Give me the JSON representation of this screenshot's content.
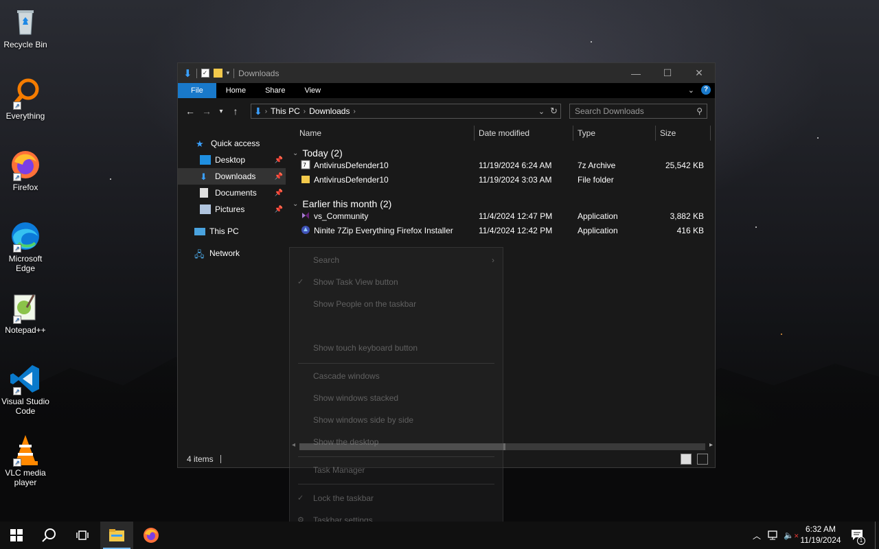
{
  "desktop_icons": [
    {
      "label": "Recycle Bin",
      "icon": "recycle-bin-icon"
    },
    {
      "label": "Everything",
      "icon": "everything-search-icon"
    },
    {
      "label": "Firefox",
      "icon": "firefox-icon"
    },
    {
      "label": "Microsoft Edge",
      "icon": "edge-icon"
    },
    {
      "label": "Notepad++",
      "icon": "notepadpp-icon"
    },
    {
      "label": "Visual Studio Code",
      "icon": "vscode-icon"
    },
    {
      "label": "VLC media player",
      "icon": "vlc-icon"
    }
  ],
  "window": {
    "title": "Downloads",
    "ribbon_tabs": [
      "File",
      "Home",
      "Share",
      "View"
    ],
    "address": {
      "crumbs": [
        "This PC",
        "Downloads"
      ]
    },
    "search_placeholder": "Search Downloads",
    "nav": {
      "quick_access": "Quick access",
      "items": [
        "Desktop",
        "Downloads",
        "Documents",
        "Pictures"
      ],
      "this_pc": "This PC",
      "network": "Network"
    },
    "columns": [
      "Name",
      "Date modified",
      "Type",
      "Size"
    ],
    "groups": [
      {
        "label": "Today (2)",
        "rows": [
          {
            "name": "AntivirusDefender10",
            "date": "11/19/2024 6:24 AM",
            "type": "7z Archive",
            "size": "25,542 KB",
            "icon": "7z-archive-icon"
          },
          {
            "name": "AntivirusDefender10",
            "date": "11/19/2024 3:03 AM",
            "type": "File folder",
            "size": "",
            "icon": "folder-icon"
          }
        ]
      },
      {
        "label": "Earlier this month (2)",
        "rows": [
          {
            "name": "vs_Community",
            "date": "11/4/2024 12:47 PM",
            "type": "Application",
            "size": "3,882 KB",
            "icon": "visual-studio-installer-icon"
          },
          {
            "name": "Ninite 7Zip Everything Firefox Installer",
            "date": "11/4/2024 12:42 PM",
            "type": "Application",
            "size": "416 KB",
            "icon": "ninite-icon"
          }
        ]
      }
    ],
    "status": "4 items"
  },
  "ghost_menu": {
    "items": [
      "Search",
      "Show Task View button",
      "Show People on the taskbar",
      "Show touch keyboard button",
      "Cascade windows",
      "Show windows stacked",
      "Show windows side by side",
      "Show the desktop",
      "Task Manager",
      "Lock the taskbar",
      "Taskbar settings"
    ]
  },
  "taskbar": {
    "time": "6:32 AM",
    "date": "11/19/2024",
    "notification_count": "1"
  },
  "colors": {
    "accent": "#1979ca",
    "folder": "#f3c94b",
    "taskbar": "#101010"
  }
}
